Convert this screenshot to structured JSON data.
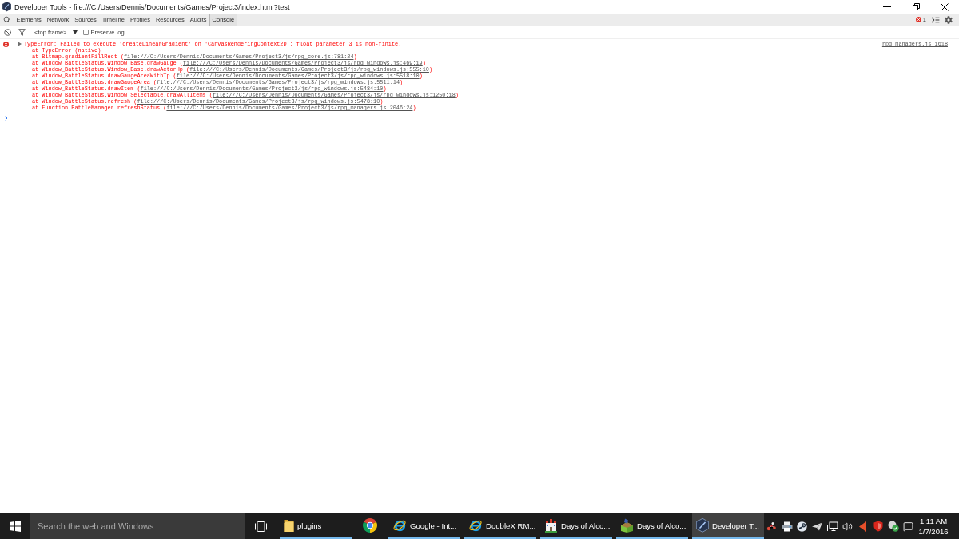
{
  "window": {
    "title": "Developer Tools - file:///C:/Users/Dennis/Documents/Games/Project3/index.html?test"
  },
  "tabs": [
    {
      "label": "Elements",
      "selected": false
    },
    {
      "label": "Network",
      "selected": false
    },
    {
      "label": "Sources",
      "selected": false
    },
    {
      "label": "Timeline",
      "selected": false
    },
    {
      "label": "Profiles",
      "selected": false
    },
    {
      "label": "Resources",
      "selected": false
    },
    {
      "label": "Audits",
      "selected": false
    },
    {
      "label": "Console",
      "selected": true
    }
  ],
  "status": {
    "error_count": "1"
  },
  "filter_bar": {
    "context": "<top frame>",
    "preserve_log": {
      "label": "Preserve log",
      "checked": false
    }
  },
  "console": {
    "messages": [
      {
        "kind": "error",
        "text": "TypeError: Failed to execute 'createLinearGradient' on 'CanvasRenderingContext2D': float parameter 3 is non-finite.",
        "source": "rpg_managers.js:1618",
        "stack": [
          {
            "call": "at TypeError (native)"
          },
          {
            "call": "at Bitmap.gradientFillRect (",
            "link": "file:///C:/Users/Dennis/Documents/Games/Project3/js/rpg_core.js:781:24",
            "close": ")"
          },
          {
            "call": "at Window_BattleStatus.Window_Base.drawGauge (",
            "link": "file:///C:/Users/Dennis/Documents/Games/Project3/js/rpg_windows.js:469:19",
            "close": ")"
          },
          {
            "call": "at Window_BattleStatus.Window_Base.drawActorHp (",
            "link": "file:///C:/Users/Dennis/Documents/Games/Project3/js/rpg_windows.js:555:10",
            "close": ")"
          },
          {
            "call": "at Window_BattleStatus.drawGaugeAreaWithTp (",
            "link": "file:///C:/Users/Dennis/Documents/Games/Project3/js/rpg_windows.js:5518:10",
            "close": ")"
          },
          {
            "call": "at Window_BattleStatus.drawGaugeArea (",
            "link": "file:///C:/Users/Dennis/Documents/Games/Project3/js/rpg_windows.js:5511:14",
            "close": ")"
          },
          {
            "call": "at Window_BattleStatus.drawItem (",
            "link": "file:///C:/Users/Dennis/Documents/Games/Project3/js/rpg_windows.js:5484:10",
            "close": ")"
          },
          {
            "call": "at Window_BattleStatus.Window_Selectable.drawAllItems (",
            "link": "file:///C:/Users/Dennis/Documents/Games/Project3/js/rpg_windows.js:1250:18",
            "close": ")"
          },
          {
            "call": "at Window_BattleStatus.refresh (",
            "link": "file:///C:/Users/Dennis/Documents/Games/Project3/js/rpg_windows.js:5478:10",
            "close": ")"
          },
          {
            "call": "at Function.BattleManager.refreshStatus (",
            "link": "file:///C:/Users/Dennis/Documents/Games/Project3/js/rpg_managers.js:2046:24",
            "close": ")"
          }
        ]
      }
    ]
  },
  "taskbar": {
    "search": {
      "placeholder": "Search the web and Windows"
    },
    "apps": [
      {
        "kind": "folder",
        "label": "plugins",
        "running": true,
        "selected": false
      },
      {
        "kind": "chrome",
        "running": false,
        "selected": false
      },
      {
        "kind": "ie",
        "label": "Google - Int...",
        "running": true,
        "selected": false
      },
      {
        "kind": "ie",
        "label": "DoubleX RM...",
        "running": true,
        "selected": false
      },
      {
        "kind": "castle",
        "label": "Days of Alco...",
        "running": true,
        "selected": false
      },
      {
        "kind": "cube",
        "label": "Days of Alco...",
        "running": true,
        "selected": false
      },
      {
        "kind": "devtools",
        "label": "Developer T...",
        "running": true,
        "selected": true
      }
    ],
    "clock": {
      "time": "1:11 AM",
      "date": "1/7/2016"
    }
  }
}
